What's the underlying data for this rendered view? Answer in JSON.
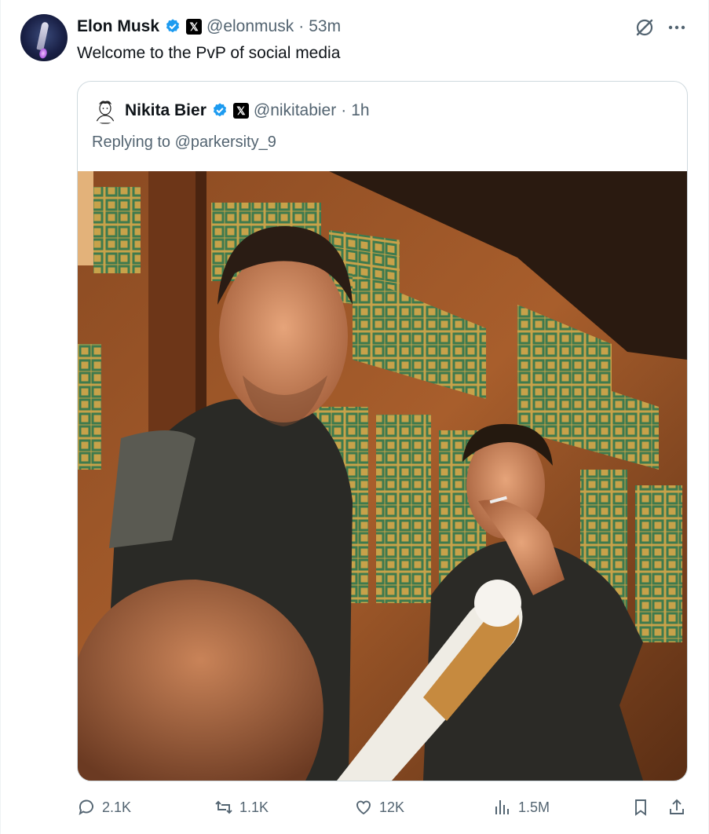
{
  "post": {
    "author_name": "Elon Musk",
    "author_handle": "@elonmusk",
    "separator": "·",
    "time": "53m",
    "text": "Welcome to the PvP of social media"
  },
  "quoted": {
    "author_name": "Nikita Bier",
    "author_handle": "@nikitabier",
    "separator": "·",
    "time": "1h",
    "reply_prefix": "Replying to ",
    "reply_to": "@parkersity_9"
  },
  "actions": {
    "replies": "2.1K",
    "reposts": "1.1K",
    "likes": "12K",
    "views": "1.5M"
  },
  "icons": [
    "verified-badge-icon",
    "x-logo-icon",
    "grok-icon",
    "more-icon",
    "reply-icon",
    "repost-icon",
    "like-icon",
    "views-icon",
    "bookmark-icon",
    "share-icon"
  ],
  "colors": {
    "verified": "#1d9bf0",
    "muted": "#536471",
    "border": "#cfd9de"
  }
}
